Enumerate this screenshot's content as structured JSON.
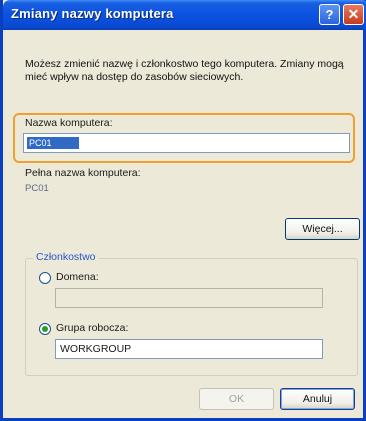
{
  "window": {
    "title": "Zmiany nazwy komputera",
    "help_symbol": "?",
    "close_symbol": "✕"
  },
  "description": "Możesz zmienić nazwę i członkostwo tego komputera. Zmiany mogą mieć wpływ na dostęp do zasobów sieciowych.",
  "computer_name": {
    "label": "Nazwa komputera:",
    "value": "PC01"
  },
  "full_name": {
    "label": "Pełna nazwa komputera:",
    "value": "PC01"
  },
  "buttons": {
    "more": "Więcej...",
    "ok": "OK",
    "cancel": "Anuluj"
  },
  "membership": {
    "title": "Członkostwo",
    "domain_label": "Domena:",
    "domain_value": "",
    "domain_selected": false,
    "workgroup_label": "Grupa robocza:",
    "workgroup_value": "WORKGROUP",
    "workgroup_selected": true
  },
  "colors": {
    "titlebar": "#0b54e3",
    "highlight": "#f0a030",
    "selection": "#316ac5"
  }
}
